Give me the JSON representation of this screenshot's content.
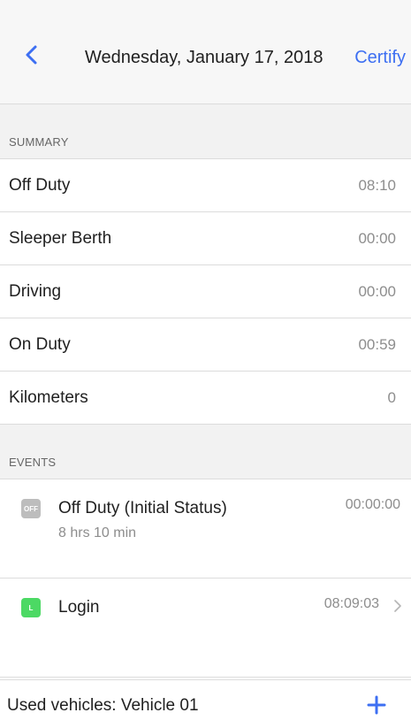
{
  "header": {
    "title": "Wednesday, January 17, 2018",
    "certify_label": "Certify",
    "back_icon": "chevron-left-icon",
    "accent_color": "#3d6ff2"
  },
  "summary": {
    "section_label": "SUMMARY",
    "rows": [
      {
        "label": "Off Duty",
        "value": "08:10"
      },
      {
        "label": "Sleeper Berth",
        "value": "00:00"
      },
      {
        "label": "Driving",
        "value": "00:00"
      },
      {
        "label": "On Duty",
        "value": "00:59"
      },
      {
        "label": "Kilometers",
        "value": "0"
      }
    ]
  },
  "events": {
    "section_label": "EVENTS",
    "items": [
      {
        "badge": "OFF",
        "badge_color": "#bdbdbd",
        "title": "Off Duty (Initial Status)",
        "duration": "8 hrs 10 min",
        "time": "00:00:00"
      },
      {
        "badge": "L",
        "badge_color": "#4cd964",
        "title": "Login",
        "time": "08:09:03"
      }
    ]
  },
  "footer": {
    "label": "Used vehicles: Vehicle 01",
    "add_icon": "plus-icon"
  }
}
